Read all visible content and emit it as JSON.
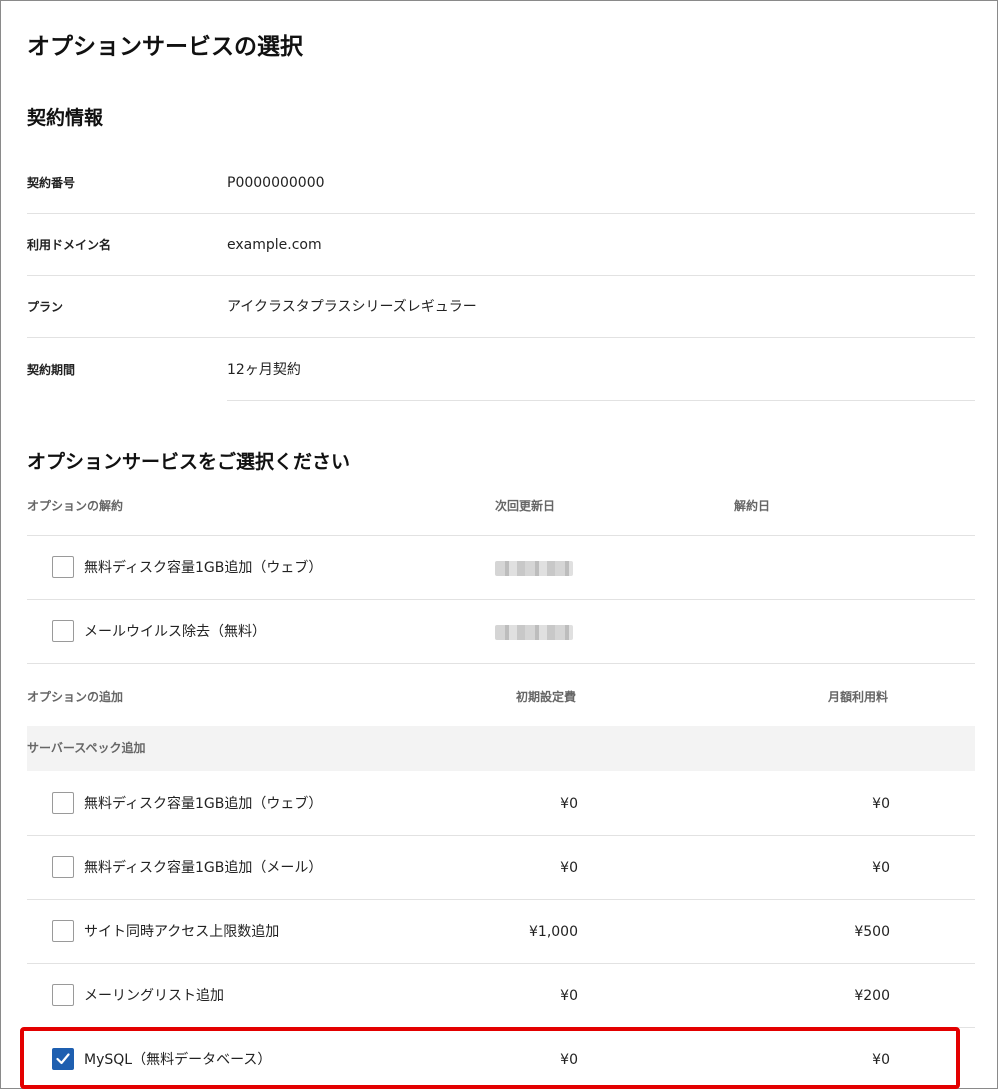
{
  "page": {
    "title": "オプションサービスの選択"
  },
  "contract": {
    "section_title": "契約情報",
    "rows": [
      {
        "label": "契約番号",
        "value": "P0000000000"
      },
      {
        "label": "利用ドメイン名",
        "value": "example.com"
      },
      {
        "label": "プラン",
        "value": "アイクラスタプラスシリーズレギュラー"
      },
      {
        "label": "契約期間",
        "value": "12ヶ月契約"
      }
    ]
  },
  "options": {
    "section_title": "オプションサービスをご選択ください",
    "cancel": {
      "headers": {
        "name": "オプションの解約",
        "next_renewal": "次回更新日",
        "cancel_date": "解約日"
      },
      "items": [
        {
          "label": "無料ディスク容量1GB追加（ウェブ）",
          "checked": false
        },
        {
          "label": "メールウイルス除去（無料）",
          "checked": false
        }
      ]
    },
    "add": {
      "headers": {
        "name": "オプションの追加",
        "setup_fee": "初期設定費",
        "monthly_fee": "月額利用料"
      },
      "group": "サーバースペック追加",
      "items": [
        {
          "label": "無料ディスク容量1GB追加（ウェブ）",
          "setup": "¥0",
          "monthly": "¥0",
          "checked": false
        },
        {
          "label": "無料ディスク容量1GB追加（メール）",
          "setup": "¥0",
          "monthly": "¥0",
          "checked": false
        },
        {
          "label": "サイト同時アクセス上限数追加",
          "setup": "¥1,000",
          "monthly": "¥500",
          "checked": false
        },
        {
          "label": "メーリングリスト追加",
          "setup": "¥0",
          "monthly": "¥200",
          "checked": false
        },
        {
          "label": "MySQL（無料データベース）",
          "setup": "¥0",
          "monthly": "¥0",
          "checked": true
        }
      ]
    }
  },
  "colors": {
    "accent": "#1e5fb0",
    "highlight": "#e30000"
  }
}
